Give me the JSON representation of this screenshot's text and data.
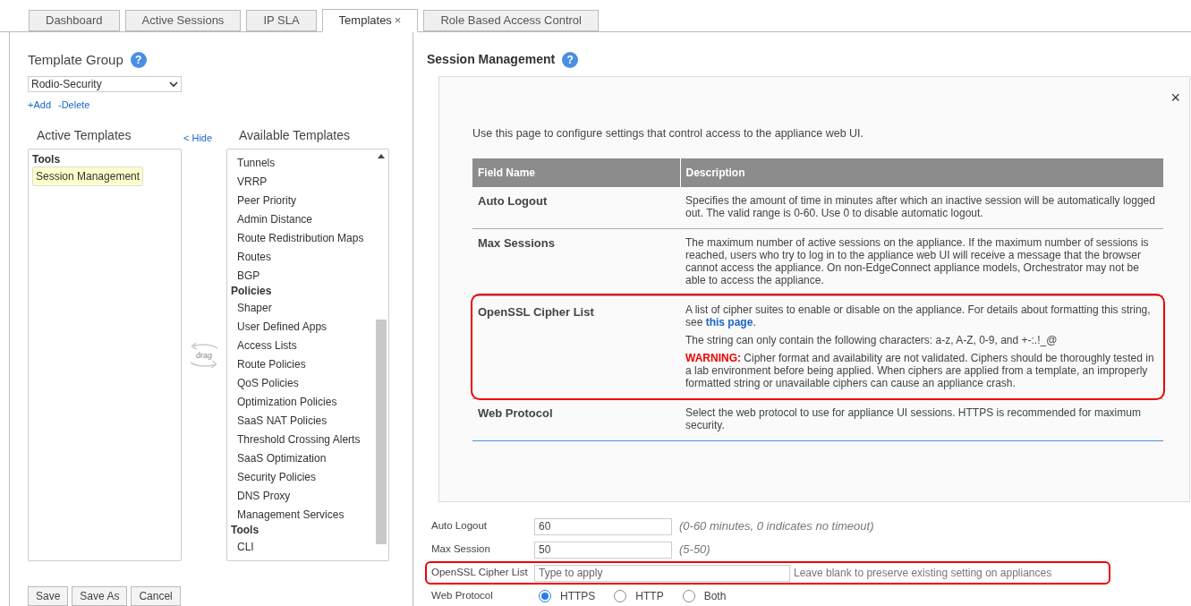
{
  "tabs": [
    {
      "label": "Dashboard",
      "selected": false
    },
    {
      "label": "Active Sessions",
      "selected": false
    },
    {
      "label": "IP SLA",
      "selected": false
    },
    {
      "label": "Templates",
      "selected": true,
      "close": "×"
    },
    {
      "label": "Role Based Access Control",
      "selected": false
    }
  ],
  "template_group": {
    "label": "Template Group",
    "help": "?",
    "value": "Rodio-Security",
    "add": "+Add",
    "delete": "-Delete"
  },
  "active_templates": {
    "title": "Active Templates",
    "hide": "< Hide",
    "groups": [
      {
        "name": "Tools",
        "items": [
          {
            "label": "Session Management",
            "selected": true
          }
        ]
      }
    ]
  },
  "drag_hint": "drag",
  "available_templates": {
    "title": "Available Templates",
    "groups": [
      {
        "items": [
          {
            "label": "Tunnels",
            "selected": false
          },
          {
            "label": "VRRP",
            "selected": false
          },
          {
            "label": "Peer Priority",
            "selected": false
          },
          {
            "label": "Admin Distance",
            "selected": false
          },
          {
            "label": "Route Redistribution Maps",
            "selected": false
          },
          {
            "label": "Routes",
            "selected": false
          },
          {
            "label": "BGP",
            "selected": false
          }
        ]
      },
      {
        "name": "Policies",
        "items": [
          {
            "label": "Shaper",
            "selected": false
          },
          {
            "label": "User Defined Apps",
            "selected": false
          },
          {
            "label": "Access Lists",
            "selected": false
          },
          {
            "label": "Route Policies",
            "selected": false
          },
          {
            "label": "QoS Policies",
            "selected": false
          },
          {
            "label": "Optimization Policies",
            "selected": false
          },
          {
            "label": "SaaS NAT Policies",
            "selected": false
          },
          {
            "label": "Threshold Crossing Alerts",
            "selected": false
          },
          {
            "label": "SaaS Optimization",
            "selected": false
          },
          {
            "label": "Security Policies",
            "selected": false
          },
          {
            "label": "DNS Proxy",
            "selected": false
          },
          {
            "label": "Management Services",
            "selected": false
          }
        ]
      },
      {
        "name": "Tools",
        "items": [
          {
            "label": "CLI",
            "selected": false
          }
        ]
      }
    ]
  },
  "buttons": [
    "Save",
    "Save As",
    "Cancel"
  ],
  "section_title": "Session Management",
  "section_help": "?",
  "help": {
    "close": "×",
    "intro": "Use this page to configure settings that control access to the appliance web UI.",
    "columns": [
      "Field Name",
      "Description"
    ],
    "rows": [
      {
        "field": "Auto Logout",
        "highlighted": false,
        "paragraphs": [
          {
            "text": "Specifies the amount of time in minutes after which an inactive session will be automatically logged out. The valid range is 0-60. Use 0 to disable automatic logout."
          }
        ]
      },
      {
        "field": "Max Sessions",
        "highlighted": false,
        "paragraphs": [
          {
            "text": "The maximum number of active sessions on the appliance. If the maximum number of sessions is reached, users who try to log in to the appliance web UI will receive a message that the browser cannot access the appliance. On non-EdgeConnect appliance models, Orchestrator may not be able to access the appliance."
          }
        ]
      },
      {
        "field": "OpenSSL Cipher List",
        "highlighted": true,
        "paragraphs": [
          {
            "text": "A list of cipher suites to enable or disable on the appliance. For details about formatting this string, see ",
            "link": "this page",
            "after": "."
          },
          {
            "text": "The string can only contain the following characters: a-z, A-Z, 0-9, and +-:.!_@"
          },
          {
            "warning": "WARNING:",
            "text": " Cipher format and availability are not validated. Ciphers should be thoroughly tested in a lab environment before being applied. When ciphers are applied from a template, an improperly formatted string or unavailable ciphers can cause an appliance crash."
          }
        ]
      },
      {
        "field": "Web Protocol",
        "highlighted": false,
        "paragraphs": [
          {
            "text": "Select the web protocol to use for appliance UI sessions. HTTPS is recommended for maximum security."
          }
        ]
      }
    ]
  },
  "form": [
    {
      "kind": "text",
      "label": "Auto Logout",
      "value": "60",
      "hint": "(0-60 minutes, 0 indicates no timeout)",
      "highlighted": false
    },
    {
      "kind": "text",
      "label": "Max Session",
      "value": "50",
      "hint": "(5-50)",
      "highlighted": false
    },
    {
      "kind": "text",
      "label": "OpenSSL Cipher List",
      "placeholder": "Type to apply",
      "note": "Leave blank to preserve existing setting on appliances",
      "highlighted": true
    },
    {
      "kind": "radio",
      "label": "Web Protocol",
      "options": [
        {
          "label": "HTTPS",
          "selected": true
        },
        {
          "label": "HTTP",
          "selected": false
        },
        {
          "label": "Both",
          "selected": false
        }
      ]
    }
  ]
}
